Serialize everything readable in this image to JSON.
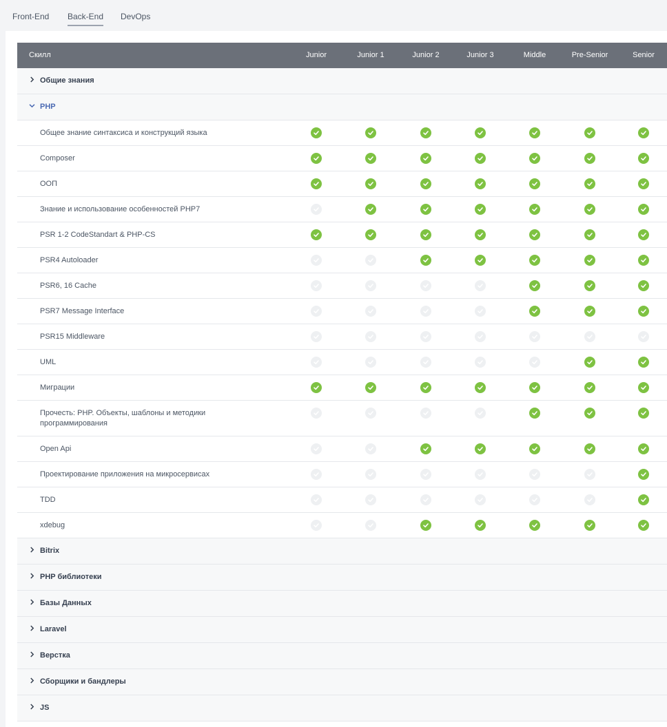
{
  "tabs": [
    {
      "label": "Front-End",
      "active": false
    },
    {
      "label": "Back-End",
      "active": true
    },
    {
      "label": "DevOps",
      "active": false
    }
  ],
  "table": {
    "skill_header": "Скилл",
    "levels": [
      "Junior",
      "Junior 1",
      "Junior 2",
      "Junior 3",
      "Middle",
      "Pre-Senior",
      "Senior"
    ]
  },
  "groups": [
    {
      "label": "Общие знания",
      "expanded": false,
      "icon": "chevron-right-icon"
    },
    {
      "label": "PHP",
      "expanded": true,
      "icon": "chevron-down-icon",
      "skills": [
        {
          "label": "Общее знание синтаксиса и конструкций языка",
          "levels": [
            1,
            1,
            1,
            1,
            1,
            1,
            1
          ]
        },
        {
          "label": "Composer",
          "levels": [
            1,
            1,
            1,
            1,
            1,
            1,
            1
          ]
        },
        {
          "label": "ООП",
          "levels": [
            1,
            1,
            1,
            1,
            1,
            1,
            1
          ]
        },
        {
          "label": "Знание и использование особенностей PHP7",
          "levels": [
            0,
            1,
            1,
            1,
            1,
            1,
            1
          ]
        },
        {
          "label": "PSR 1-2 CodeStandart & PHP-CS",
          "levels": [
            1,
            1,
            1,
            1,
            1,
            1,
            1
          ]
        },
        {
          "label": "PSR4 Autoloader",
          "levels": [
            0,
            0,
            1,
            1,
            1,
            1,
            1
          ]
        },
        {
          "label": "PSR6, 16 Cache",
          "levels": [
            0,
            0,
            0,
            0,
            1,
            1,
            1
          ]
        },
        {
          "label": "PSR7 Message Interface",
          "levels": [
            0,
            0,
            0,
            0,
            1,
            1,
            1
          ]
        },
        {
          "label": "PSR15 Middleware",
          "levels": [
            0,
            0,
            0,
            0,
            0,
            0,
            0
          ]
        },
        {
          "label": "UML",
          "levels": [
            0,
            0,
            0,
            0,
            0,
            1,
            1
          ]
        },
        {
          "label": "Миграции",
          "levels": [
            1,
            1,
            1,
            1,
            1,
            1,
            1
          ]
        },
        {
          "label": "Прочесть: PHP. Объекты, шаблоны и методики программирования",
          "levels": [
            0,
            0,
            0,
            0,
            1,
            1,
            1
          ],
          "tall": true
        },
        {
          "label": "Open Api",
          "levels": [
            0,
            0,
            1,
            1,
            1,
            1,
            1
          ]
        },
        {
          "label": "Проектирование приложения на микросервисах",
          "levels": [
            0,
            0,
            0,
            0,
            0,
            0,
            1
          ]
        },
        {
          "label": "TDD",
          "levels": [
            0,
            0,
            0,
            0,
            0,
            0,
            1
          ]
        },
        {
          "label": "xdebug",
          "levels": [
            0,
            0,
            1,
            1,
            1,
            1,
            1
          ]
        }
      ]
    },
    {
      "label": "Bitrix",
      "expanded": false,
      "icon": "chevron-right-icon"
    },
    {
      "label": "PHP библиотеки",
      "expanded": false,
      "icon": "chevron-right-icon"
    },
    {
      "label": "Базы Данных",
      "expanded": false,
      "icon": "chevron-right-icon"
    },
    {
      "label": "Laravel",
      "expanded": false,
      "icon": "chevron-right-icon"
    },
    {
      "label": "Верстка",
      "expanded": false,
      "icon": "chevron-right-icon"
    },
    {
      "label": "Сборщики и бандлеры",
      "expanded": false,
      "icon": "chevron-right-icon"
    },
    {
      "label": "JS",
      "expanded": false,
      "icon": "chevron-right-icon"
    }
  ],
  "colors": {
    "check_on": "#7ec242",
    "check_off": "#eef0f2",
    "header_bg": "#6b7079",
    "active_group": "#4b6ab3"
  }
}
